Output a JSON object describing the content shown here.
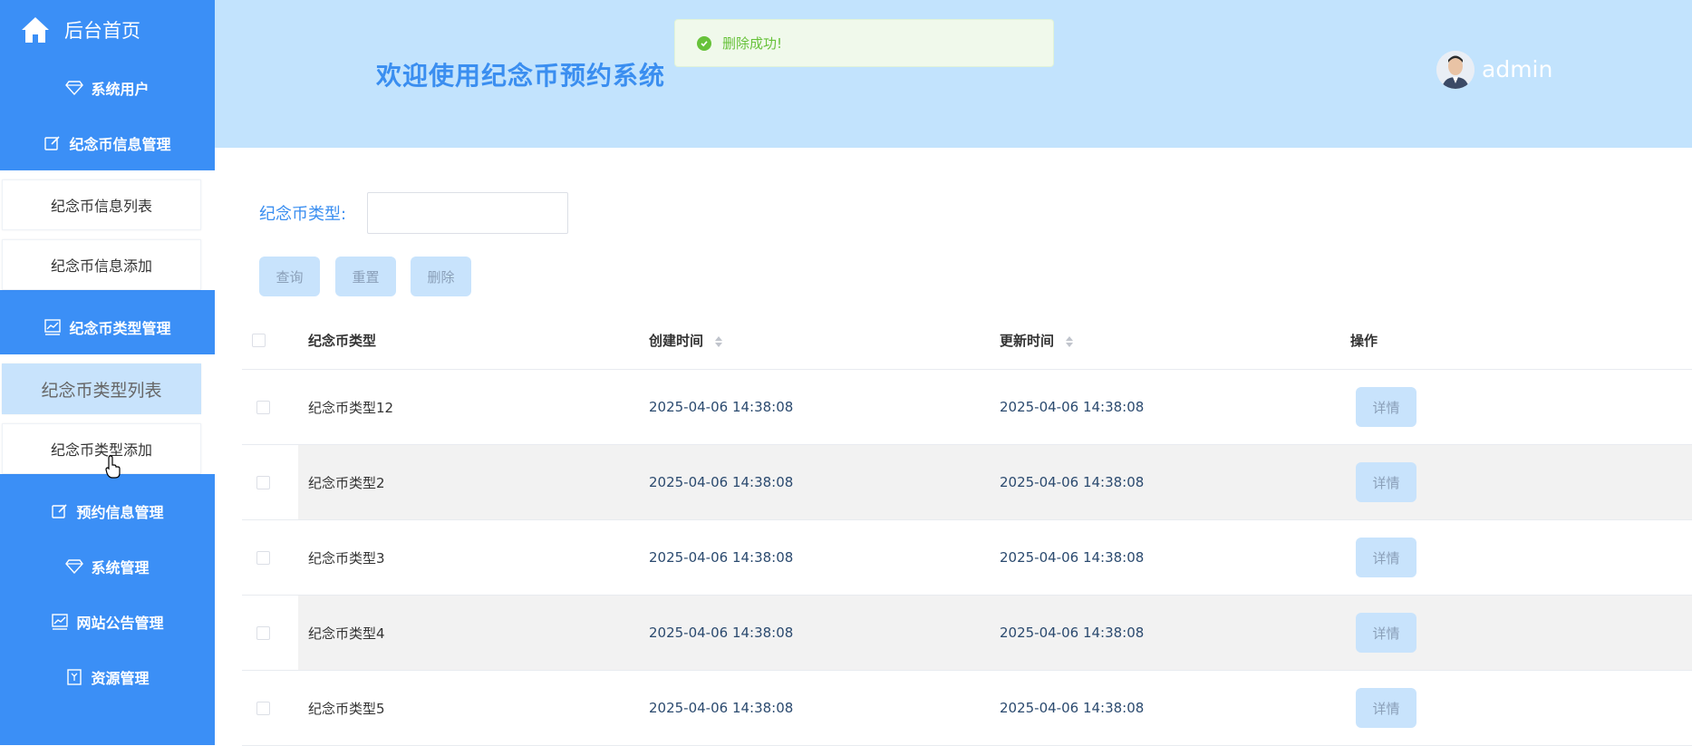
{
  "sidebar": {
    "home_label": "后台首页",
    "menus": {
      "system_users": "系统用户",
      "coin_info_mgmt": "纪念币信息管理",
      "coin_info_list": "纪念币信息列表",
      "coin_info_add": "纪念币信息添加",
      "coin_type_mgmt": "纪念币类型管理",
      "coin_type_list": "纪念币类型列表",
      "coin_type_add": "纪念币类型添加",
      "reservation_mgmt": "预约信息管理",
      "system_mgmt": "系统管理",
      "announcement_mgmt": "网站公告管理",
      "resource_mgmt": "资源管理"
    }
  },
  "header": {
    "title": "欢迎使用纪念币预约系统",
    "username": "admin"
  },
  "toast": {
    "message": "删除成功!"
  },
  "filter": {
    "label": "纪念币类型:",
    "value": "",
    "buttons": {
      "query": "查询",
      "reset": "重置",
      "delete": "删除"
    }
  },
  "table": {
    "headers": {
      "type": "纪念币类型",
      "created": "创建时间",
      "updated": "更新时间",
      "actions": "操作"
    },
    "detail_label": "详情",
    "rows": [
      {
        "type": "纪念币类型12",
        "created": "2025-04-06 14:38:08",
        "updated": "2025-04-06 14:38:08"
      },
      {
        "type": "纪念币类型2",
        "created": "2025-04-06 14:38:08",
        "updated": "2025-04-06 14:38:08"
      },
      {
        "type": "纪念币类型3",
        "created": "2025-04-06 14:38:08",
        "updated": "2025-04-06 14:38:08"
      },
      {
        "type": "纪念币类型4",
        "created": "2025-04-06 14:38:08",
        "updated": "2025-04-06 14:38:08"
      },
      {
        "type": "纪念币类型5",
        "created": "2025-04-06 14:38:08",
        "updated": "2025-04-06 14:38:08"
      }
    ]
  },
  "colors": {
    "sidebar": "#3b8ff6",
    "header": "#c2e3fd",
    "accent": "#3a8ef0",
    "button": "#c8e3fc",
    "success": "#67c23a"
  }
}
